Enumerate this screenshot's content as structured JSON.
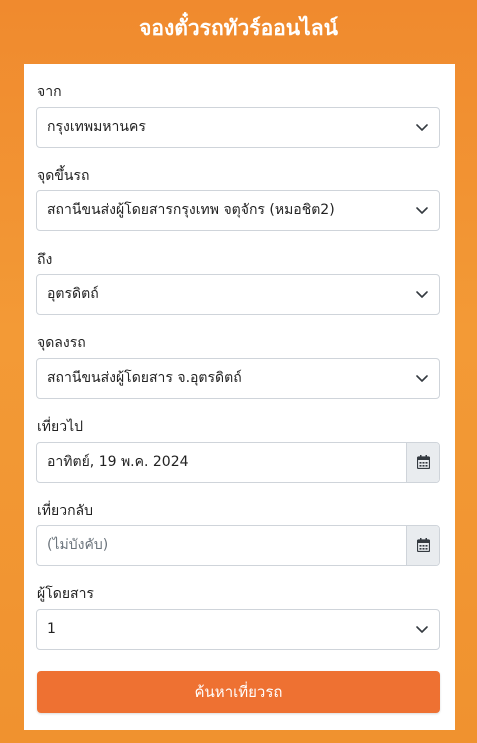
{
  "header": {
    "title": "จองตั๋วรถทัวร์ออนไลน์"
  },
  "form": {
    "from": {
      "label": "จาก",
      "value": "กรุงเทพมหานคร"
    },
    "pickup": {
      "label": "จุดขึ้นรถ",
      "value": "สถานีขนส่งผู้โดยสารกรุงเทพ จตุจักร (หมอชิต2)"
    },
    "to": {
      "label": "ถึง",
      "value": "อุตรดิตถ์"
    },
    "dropoff": {
      "label": "จุดลงรถ",
      "value": "สถานีขนส่งผู้โดยสาร จ.อุตรดิตถ์"
    },
    "depart": {
      "label": "เที่ยวไป",
      "value": "อาทิตย์, 19 พ.ค. 2024"
    },
    "return": {
      "label": "เที่ยวกลับ",
      "placeholder": "(ไม่บังคับ)"
    },
    "passengers": {
      "label": "ผู้โดยสาร",
      "value": "1"
    },
    "search_label": "ค้นหาเที่ยวรถ"
  },
  "icons": {
    "select": "chevron-down-icon",
    "date": "calendar-icon"
  },
  "colors": {
    "background": "#f39a36",
    "button": "#ee7132",
    "addon": "#e9ecef"
  }
}
